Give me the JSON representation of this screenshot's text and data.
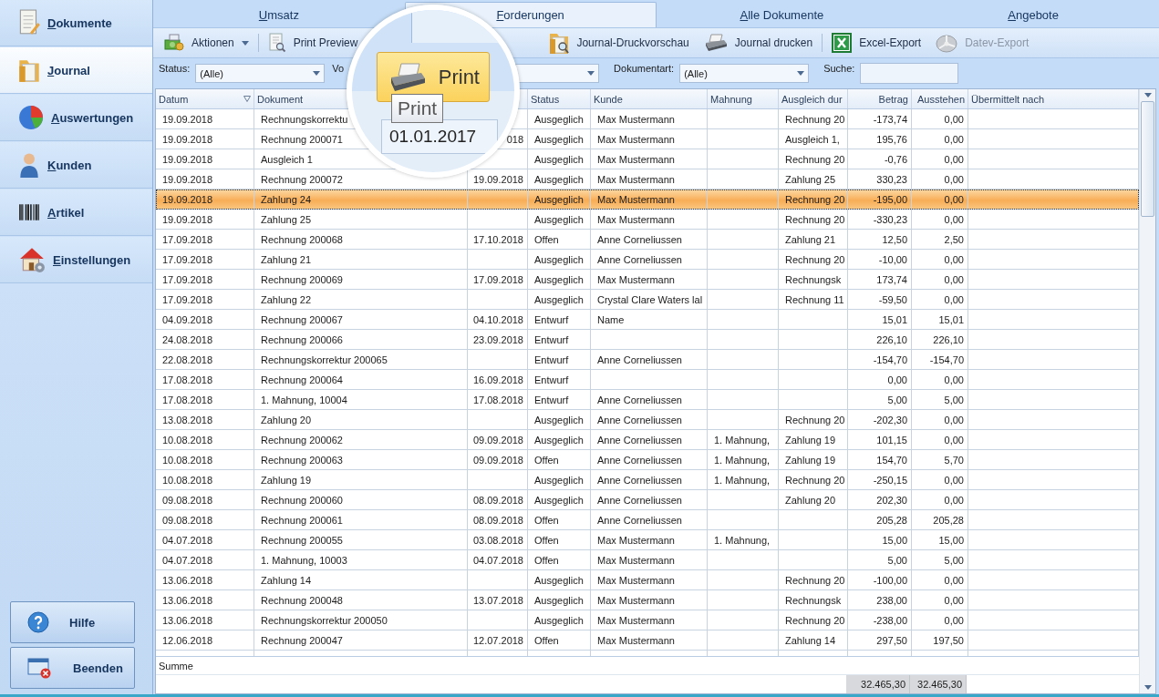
{
  "sidebar": {
    "items": [
      {
        "label": "Dokumente",
        "selected": false
      },
      {
        "label": "Journal",
        "selected": true
      },
      {
        "label": "Auswertungen",
        "selected": false
      },
      {
        "label": "Kunden",
        "selected": false
      },
      {
        "label": "Artikel",
        "selected": false
      },
      {
        "label": "Einstellungen",
        "selected": false
      }
    ],
    "buttons": [
      "Hilfe",
      "Beenden"
    ]
  },
  "tabs": [
    {
      "label": "Umsatz",
      "selected": false
    },
    {
      "label": "Forderungen",
      "selected": true
    },
    {
      "label": "Alle Dokumente",
      "selected": false
    },
    {
      "label": "Angebote",
      "selected": false
    }
  ],
  "toolbar": [
    {
      "label": "Aktionen",
      "disabled": false
    },
    {
      "label": "Print Preview",
      "disabled": false
    },
    {
      "label": "Journal-Druckvorschau",
      "disabled": false
    },
    {
      "label": "Journal drucken",
      "disabled": false
    },
    {
      "label": "Excel-Export",
      "disabled": false
    },
    {
      "label": "Datev-Export",
      "disabled": true
    }
  ],
  "filters": {
    "status_label": "Status:",
    "status_value": "(Alle)",
    "partial_label": "Vo",
    "doctype_label": "Dokumentart:",
    "doctype_value": "(Alle)",
    "search_label": "Suche:"
  },
  "magnifier": {
    "button": "Print",
    "tooltip": "Print",
    "date_value": "01.01.2017"
  },
  "table": {
    "columns": [
      {
        "label": "Datum",
        "sorted": true
      },
      {
        "label": "Dokument"
      },
      {},
      {
        "label": "Status",
        "sorted": false
      },
      {
        "label": "Kunde",
        "sorted": false
      },
      {
        "label": "Mahnung",
        "sorted": false
      },
      {
        "label": "Ausgleich dur",
        "sorted": false
      },
      {
        "label": "Betrag",
        "sorted": false
      },
      {
        "label": "Ausstehen",
        "sorted": false
      },
      {
        "label": "Übermittelt nach",
        "sorted": false
      }
    ],
    "rows": [
      {
        "selected": false,
        "cells": [
          "19.09.2018",
          "Rechnungskorrektu",
          null,
          "Ausgeglich",
          "Max Mustermann",
          null,
          "Rechnung 20",
          "-173,74",
          "0,00"
        ]
      },
      {
        "selected": false,
        "cells": [
          "19.09.2018",
          "Rechnung 200071",
          "018",
          "Ausgeglich",
          "Max Mustermann",
          null,
          "Ausgleich 1,",
          "195,76",
          "0,00"
        ]
      },
      {
        "selected": false,
        "cells": [
          "19.09.2018",
          "Ausgleich 1",
          null,
          "Ausgeglich",
          "Max Mustermann",
          null,
          "Rechnung 20",
          "-0,76",
          "0,00"
        ]
      },
      {
        "selected": false,
        "cells": [
          "19.09.2018",
          "Rechnung 200072",
          "19.09.2018",
          "Ausgeglich",
          "Max Mustermann",
          null,
          "Zahlung 25",
          "330,23",
          "0,00"
        ]
      },
      {
        "selected": true,
        "cells": [
          "19.09.2018",
          "Zahlung 24",
          null,
          "Ausgeglich",
          "Max Mustermann",
          null,
          "Rechnung 20",
          "-195,00",
          "0,00"
        ]
      },
      {
        "selected": false,
        "cells": [
          "19.09.2018",
          "Zahlung 25",
          null,
          "Ausgeglich",
          "Max Mustermann",
          null,
          "Rechnung 20",
          "-330,23",
          "0,00"
        ]
      },
      {
        "selected": false,
        "cells": [
          "17.09.2018",
          "Rechnung 200068",
          "17.10.2018",
          "Offen",
          "Anne Corneliussen",
          null,
          "Zahlung 21",
          "12,50",
          "2,50"
        ]
      },
      {
        "selected": false,
        "cells": [
          "17.09.2018",
          "Zahlung 21",
          null,
          "Ausgeglich",
          "Anne Corneliussen",
          null,
          "Rechnung 20",
          "-10,00",
          "0,00"
        ]
      },
      {
        "selected": false,
        "cells": [
          "17.09.2018",
          "Rechnung 200069",
          "17.09.2018",
          "Ausgeglich",
          "Max Mustermann",
          null,
          "Rechnungsk",
          "173,74",
          "0,00"
        ]
      },
      {
        "selected": false,
        "cells": [
          "17.09.2018",
          "Zahlung 22",
          null,
          "Ausgeglich",
          "Crystal Clare Waters lal",
          null,
          "Rechnung 11",
          "-59,50",
          "0,00"
        ]
      },
      {
        "selected": false,
        "cells": [
          "04.09.2018",
          "Rechnung 200067",
          "04.10.2018",
          "Entwurf",
          "Name",
          null,
          null,
          "15,01",
          "15,01"
        ]
      },
      {
        "selected": false,
        "cells": [
          "24.08.2018",
          "Rechnung 200066",
          "23.09.2018",
          "Entwurf",
          null,
          null,
          null,
          "226,10",
          "226,10"
        ]
      },
      {
        "selected": false,
        "cells": [
          "22.08.2018",
          "Rechnungskorrektur 200065",
          null,
          "Entwurf",
          "Anne Corneliussen",
          null,
          null,
          "-154,70",
          "-154,70"
        ]
      },
      {
        "selected": false,
        "cells": [
          "17.08.2018",
          "Rechnung 200064",
          "16.09.2018",
          "Entwurf",
          null,
          null,
          null,
          "0,00",
          "0,00"
        ]
      },
      {
        "selected": false,
        "cells": [
          "17.08.2018",
          "1. Mahnung, 10004",
          "17.08.2018",
          "Entwurf",
          "Anne Corneliussen",
          null,
          null,
          "5,00",
          "5,00"
        ]
      },
      {
        "selected": false,
        "cells": [
          "13.08.2018",
          "Zahlung 20",
          null,
          "Ausgeglich",
          "Anne Corneliussen",
          null,
          "Rechnung 20",
          "-202,30",
          "0,00"
        ]
      },
      {
        "selected": false,
        "cells": [
          "10.08.2018",
          "Rechnung 200062",
          "09.09.2018",
          "Ausgeglich",
          "Anne Corneliussen",
          "1. Mahnung,",
          "Zahlung 19",
          "101,15",
          "0,00"
        ]
      },
      {
        "selected": false,
        "cells": [
          "10.08.2018",
          "Rechnung 200063",
          "09.09.2018",
          "Offen",
          "Anne Corneliussen",
          "1. Mahnung,",
          "Zahlung 19",
          "154,70",
          "5,70"
        ]
      },
      {
        "selected": false,
        "cells": [
          "10.08.2018",
          "Zahlung 19",
          null,
          "Ausgeglich",
          "Anne Corneliussen",
          "1. Mahnung,",
          "Rechnung 20",
          "-250,15",
          "0,00"
        ]
      },
      {
        "selected": false,
        "cells": [
          "09.08.2018",
          "Rechnung 200060",
          "08.09.2018",
          "Ausgeglich",
          "Anne Corneliussen",
          null,
          "Zahlung 20",
          "202,30",
          "0,00"
        ]
      },
      {
        "selected": false,
        "cells": [
          "09.08.2018",
          "Rechnung 200061",
          "08.09.2018",
          "Offen",
          "Anne Corneliussen",
          null,
          null,
          "205,28",
          "205,28"
        ]
      },
      {
        "selected": false,
        "cells": [
          "04.07.2018",
          "Rechnung 200055",
          "03.08.2018",
          "Offen",
          "Max Mustermann",
          "1. Mahnung,",
          null,
          "15,00",
          "15,00"
        ]
      },
      {
        "selected": false,
        "cells": [
          "04.07.2018",
          "1. Mahnung, 10003",
          "04.07.2018",
          "Offen",
          "Max Mustermann",
          null,
          null,
          "5,00",
          "5,00"
        ]
      },
      {
        "selected": false,
        "cells": [
          "13.06.2018",
          "Zahlung 14",
          null,
          "Ausgeglich",
          "Max Mustermann",
          null,
          "Rechnung 20",
          "-100,00",
          "0,00"
        ]
      },
      {
        "selected": false,
        "cells": [
          "13.06.2018",
          "Rechnung 200048",
          "13.07.2018",
          "Ausgeglich",
          "Max Mustermann",
          null,
          "Rechnungsk",
          "238,00",
          "0,00"
        ]
      },
      {
        "selected": false,
        "cells": [
          "13.06.2018",
          "Rechnungskorrektur 200050",
          null,
          "Ausgeglich",
          "Max Mustermann",
          null,
          "Rechnung 20",
          "-238,00",
          "0,00"
        ]
      },
      {
        "selected": false,
        "cells": [
          "12.06.2018",
          "Rechnung 200047",
          "12.07.2018",
          "Offen",
          "Max Mustermann",
          null,
          "Zahlung 14",
          "297,50",
          "197,50"
        ]
      }
    ],
    "summary_label": "Summe",
    "totals": {
      "betrag": "32.465,30",
      "ausstehen": "32.465,30"
    }
  }
}
